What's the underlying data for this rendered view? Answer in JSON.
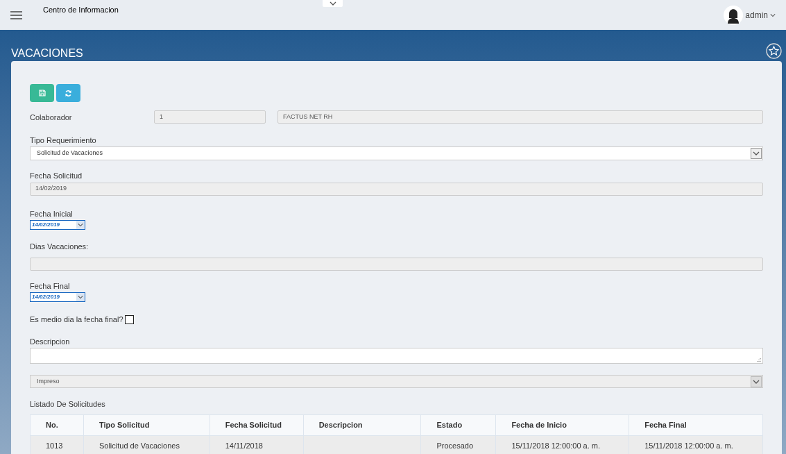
{
  "header": {
    "title": "Centro de Informacion",
    "user": "admin"
  },
  "page": {
    "title": "VACACIONES"
  },
  "form": {
    "colaborador": {
      "label": "Colaborador",
      "id": "1",
      "name": "FACTUS NET RH"
    },
    "tipo": {
      "label": "Tipo Requerimiento",
      "value": "Solicitud de Vacaciones"
    },
    "fecha_solicitud": {
      "label": "Fecha Solicitud",
      "value": "14/02/2019"
    },
    "fecha_inicial": {
      "label": "Fecha Inicial",
      "value": "14/02/2019"
    },
    "dias": {
      "label": "Dias Vacaciones:"
    },
    "fecha_final": {
      "label": "Fecha Final",
      "value": "14/02/2019"
    },
    "medio_dia": {
      "label": "Es medio dia la fecha final?",
      "checked": false
    },
    "descripcion": {
      "label": "Descripcion"
    },
    "estado_select": {
      "value": "Impreso",
      "disabled": true
    }
  },
  "table": {
    "title": "Listado De Solicitudes",
    "columns": [
      "No.",
      "Tipo Solicitud",
      "Fecha Solicitud",
      "Descripcion",
      "Estado",
      "Fecha de Inicio",
      "Fecha Final"
    ],
    "rows": [
      [
        "1013",
        "Solicitud de Vacaciones",
        "14/11/2018",
        "",
        "Procesado",
        "15/11/2018 12:00:00 a. m.",
        "15/11/2018 12:00:00 a. m."
      ]
    ]
  }
}
